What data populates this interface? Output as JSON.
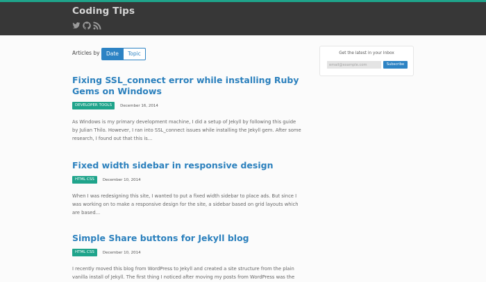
{
  "header": {
    "site_title": "Coding Tips",
    "social_icons": [
      "twitter-icon",
      "github-icon",
      "rss-icon"
    ]
  },
  "sort": {
    "label": "Articles by",
    "options": [
      "Date",
      "Topic"
    ],
    "active": "Date"
  },
  "posts": [
    {
      "title": "Fixing SSL_connect error while installing Ruby Gems on Windows",
      "tag": "DEVELOPER TOOLS",
      "date": "December 16, 2014",
      "excerpt": "As Windows is my primary development machine, I did a setup of Jekyll by following this guide by Julian Thilo. However, I ran into SSL_connect issues while installing the Jekyll gem. After some research, I found out that this is..."
    },
    {
      "title": "Fixed width sidebar in responsive design",
      "tag": "HTML CSS",
      "date": "December 10, 2014",
      "excerpt": "When I was redesigning this site, I wanted to put a fixed width sidebar to place ads. But since I was working on to make a responsive design for the site, a sidebar based on grid layouts which are based..."
    },
    {
      "title": "Simple Share buttons for Jekyll blog",
      "tag": "HTML CSS",
      "date": "December 10, 2014",
      "excerpt": "I recently moved this blog from WordPress to Jekyll and created a site structure from the plain vanilla install of Jekyll. The first thing I noticed after moving my posts from WordPress was the"
    }
  ],
  "sidebar": {
    "title": "Get the latest in your Inbox",
    "email_placeholder": "email@example.com",
    "subscribe_label": "Subscribe"
  },
  "colors": {
    "accent": "#1fa48b",
    "link": "#2b80bd",
    "header_bg": "#373737"
  }
}
